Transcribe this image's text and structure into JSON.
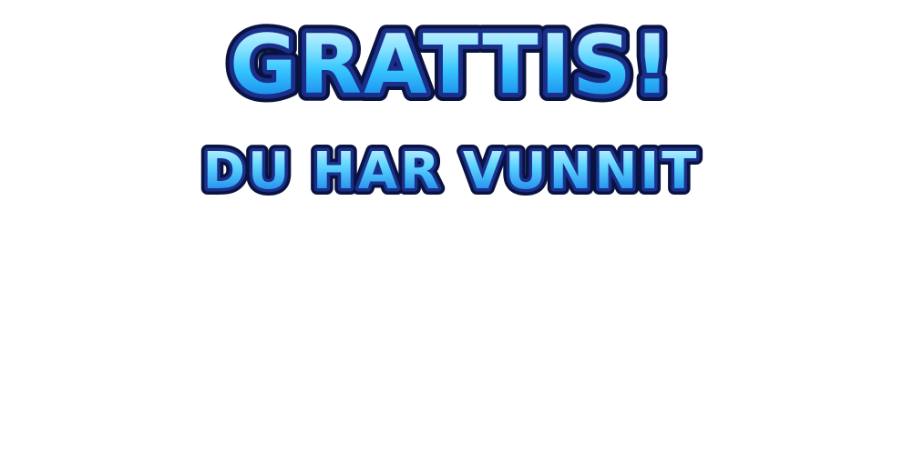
{
  "win_screen": {
    "headline": "GRATTIS!",
    "subline": "DU HAR VUNNIT"
  },
  "colors": {
    "background": "#ffffff",
    "outline_dark": "#0a1240",
    "outline_mid": "#1a2f8a",
    "fill_top": "#e8fbff",
    "fill_mid": "#37c6ff",
    "fill_bottom": "#0a6fe0"
  }
}
